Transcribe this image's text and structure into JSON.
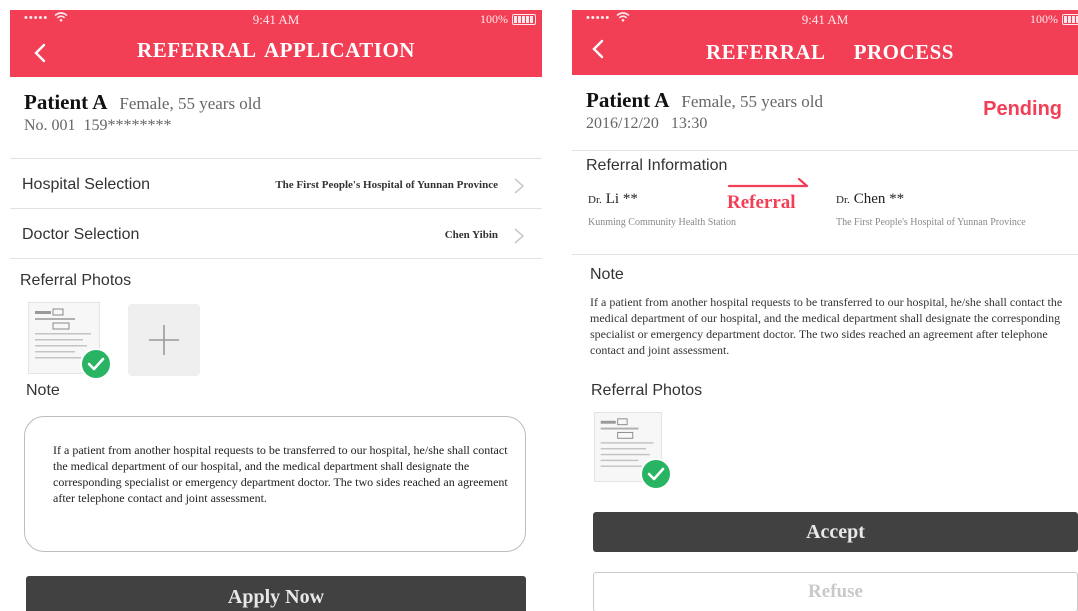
{
  "status_bar": {
    "signal": "•••••",
    "time": "9:41 AM",
    "battery": "100%"
  },
  "left": {
    "title": "REFERRAL APPLICATION",
    "patient": {
      "name": "Patient A",
      "meta": "Female, 55 years old",
      "number": "No. 001  159********"
    },
    "hospital_row": {
      "label": "Hospital Selection",
      "value": "The First People's Hospital of Yunnan Province"
    },
    "doctor_row": {
      "label": "Doctor Selection",
      "value": "Chen Yibin"
    },
    "photos_label": "Referral Photos",
    "note_label": "Note",
    "note_text": "If a patient from another hospital requests to be transferred to our hospital, he/she shall contact the medical department of our hospital, and the medical department shall designate the corresponding specialist or emergency department doctor. The two sides reached an agreement after telephone contact and joint assessment.",
    "apply_label": "Apply Now"
  },
  "right": {
    "title": "REFERRAL   PROCESS",
    "patient": {
      "name": "Patient A",
      "meta": "Female, 55 years old",
      "datetime": "2016/12/20   13:30"
    },
    "status": "Pending",
    "info_label": "Referral Information",
    "from_doctor": {
      "prefix": "Dr.",
      "name": "Li **",
      "hospital": "Kunming Community Health Station"
    },
    "referral_word": "Referral",
    "to_doctor": {
      "prefix": "Dr.",
      "name": "Chen **",
      "hospital": "The First People's Hospital of Yunnan Province"
    },
    "note_label": "Note",
    "note_text": "If a patient from another hospital requests to be transferred to our hospital, he/she shall contact the medical department of our hospital, and the medical department shall designate the corresponding specialist or emergency department doctor. The two sides reached an agreement after telephone contact and joint assessment.",
    "photos_label": "Referral Photos",
    "accept_label": "Accept",
    "refuse_label": "Refuse"
  },
  "colors": {
    "brand_red": "#f23f56",
    "check_green": "#28b463",
    "button_dark": "#414141"
  },
  "icons": [
    "back-arrow-icon",
    "chevron-right-icon",
    "check-icon",
    "plus-icon",
    "battery-icon",
    "wifi-icon",
    "arrow-right-icon"
  ]
}
